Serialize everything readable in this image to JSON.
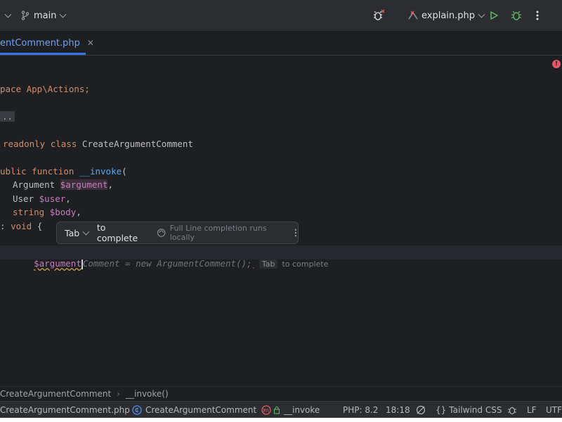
{
  "toolbar": {
    "branch": "main",
    "run_config": "explain.php"
  },
  "tab": {
    "label": "entComment.php"
  },
  "code": {
    "l1": "pace App\\Actions;",
    "l2_fold": "..",
    "l3_kw1": "readonly",
    "l3_kw2": "class",
    "l3_name": "CreateArgumentComment",
    "l4_kw1": "ublic",
    "l4_kw2": "function",
    "l4_fn": "__invoke",
    "l4_paren": "(",
    "l5_type": "Argument",
    "l5_var": "$argument",
    "l5_end": ",",
    "l6_type": "User",
    "l6_var": "$user",
    "l6_end": ",",
    "l7_type": "string",
    "l7_var": "$body",
    "l7_end": ",",
    "l8_a": ":",
    "l8_b": "void",
    "l8_c": "{",
    "l9_typed": "$argument",
    "l9_ghost": "Comment = new ArgumentComment();",
    "l9_hint_key": "Tab",
    "l9_hint_text": "to complete"
  },
  "popup": {
    "key": "Tab",
    "action": "to complete",
    "info": "Full Line completion runs locally"
  },
  "breadcrumb": {
    "class_name": "CreateArgumentComment",
    "method": "__invoke()"
  },
  "status": {
    "file": "CreateArgumentComment.php",
    "class_name": "CreateArgumentComment",
    "method": "__invoke",
    "php": "PHP: 8.2",
    "position": "18:18",
    "tailwind": "Tailwind CSS",
    "line_sep": "LF",
    "encoding": "UTF"
  },
  "colors": {
    "keyword": "#cf8e6d",
    "variable": "#c77dbb",
    "function": "#56a8f5",
    "accent": "#3574f0",
    "error": "#e55765",
    "run": "#5fb865",
    "debug": "#5fb865"
  }
}
